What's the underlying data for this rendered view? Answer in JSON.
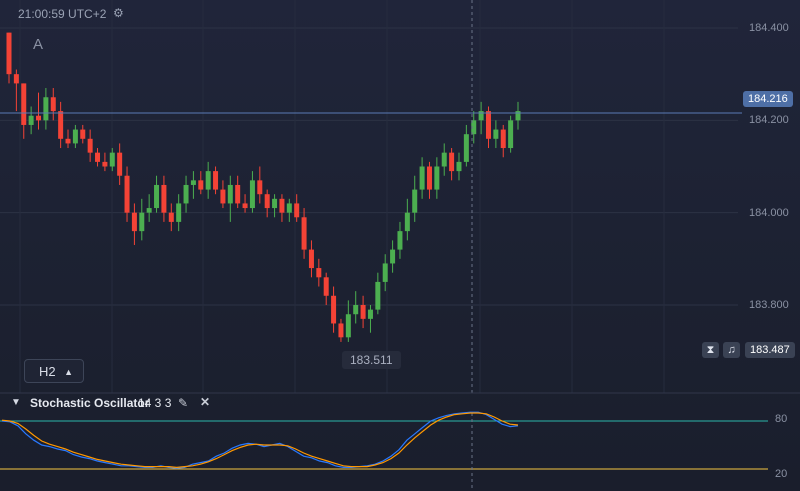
{
  "header": {
    "time": "21:00:59 UTC+2",
    "gear_icon": "gear-icon",
    "series_letter": "A"
  },
  "price_axis": {
    "ticks": [
      "184.400",
      "184.200",
      "184.000",
      "183.800"
    ],
    "current_price": "184.216",
    "ask_price": "183.487",
    "low_marker": "183.511"
  },
  "timeframe_button": {
    "label": "H2",
    "icon": "caret-up-icon"
  },
  "indicator": {
    "name": "Stochastic Oscillator",
    "params": "14 3 3",
    "edit_icon": "pencil-icon",
    "close_icon": "close-icon",
    "levels": [
      "80",
      "20"
    ]
  },
  "colors": {
    "up": "#4caf50",
    "down": "#f44336",
    "k_line": "#2979ff",
    "d_line": "#ff9800",
    "level_80": "#2bb5a9",
    "level_20": "#f5c542",
    "price_tag": "#4e6fa6"
  },
  "chart_data": [
    {
      "type": "candlestick",
      "ylim": [
        183.43,
        184.45
      ],
      "ohlc": [
        [
          184.39,
          184.39,
          184.28,
          184.3
        ],
        [
          184.3,
          184.31,
          184.22,
          184.28
        ],
        [
          184.28,
          184.28,
          184.16,
          184.19
        ],
        [
          184.19,
          184.23,
          184.17,
          184.21
        ],
        [
          184.21,
          184.26,
          184.18,
          184.2
        ],
        [
          184.2,
          184.27,
          184.18,
          184.25
        ],
        [
          184.25,
          184.27,
          184.2,
          184.22
        ],
        [
          184.22,
          184.24,
          184.14,
          184.16
        ],
        [
          184.16,
          184.18,
          184.14,
          184.15
        ],
        [
          184.15,
          184.19,
          184.14,
          184.18
        ],
        [
          184.18,
          184.19,
          184.15,
          184.16
        ],
        [
          184.16,
          184.18,
          184.11,
          184.13
        ],
        [
          184.13,
          184.14,
          184.1,
          184.11
        ],
        [
          184.11,
          184.13,
          184.09,
          184.1
        ],
        [
          184.1,
          184.14,
          184.09,
          184.13
        ],
        [
          184.13,
          184.15,
          184.06,
          184.08
        ],
        [
          184.08,
          184.1,
          183.98,
          184.0
        ],
        [
          184.0,
          184.02,
          183.93,
          183.96
        ],
        [
          183.96,
          184.03,
          183.94,
          184.0
        ],
        [
          184.0,
          184.04,
          183.98,
          184.01
        ],
        [
          184.01,
          184.08,
          184.0,
          184.06
        ],
        [
          184.06,
          184.08,
          183.98,
          184.0
        ],
        [
          184.0,
          184.02,
          183.96,
          183.98
        ],
        [
          183.98,
          184.04,
          183.96,
          184.02
        ],
        [
          184.02,
          184.08,
          184.0,
          184.06
        ],
        [
          184.06,
          184.09,
          184.03,
          184.07
        ],
        [
          184.07,
          184.09,
          184.04,
          184.05
        ],
        [
          184.05,
          184.11,
          184.03,
          184.09
        ],
        [
          184.09,
          184.1,
          184.04,
          184.05
        ],
        [
          184.05,
          184.07,
          184.01,
          184.02
        ],
        [
          184.02,
          184.08,
          183.98,
          184.06
        ],
        [
          184.06,
          184.08,
          184.01,
          184.02
        ],
        [
          184.02,
          184.04,
          184.0,
          184.01
        ],
        [
          184.01,
          184.09,
          184.0,
          184.07
        ],
        [
          184.07,
          184.1,
          184.02,
          184.04
        ],
        [
          184.04,
          184.05,
          183.99,
          184.01
        ],
        [
          184.01,
          184.04,
          183.99,
          184.03
        ],
        [
          184.03,
          184.04,
          183.98,
          184.0
        ],
        [
          184.0,
          184.03,
          183.98,
          184.02
        ],
        [
          184.02,
          184.04,
          183.98,
          183.99
        ],
        [
          183.99,
          184.01,
          183.9,
          183.92
        ],
        [
          183.92,
          183.94,
          183.86,
          183.88
        ],
        [
          183.88,
          183.9,
          183.84,
          183.86
        ],
        [
          183.86,
          183.87,
          183.8,
          183.82
        ],
        [
          183.82,
          183.84,
          183.74,
          183.76
        ],
        [
          183.76,
          183.77,
          183.72,
          183.73
        ],
        [
          183.73,
          183.81,
          183.72,
          183.78
        ],
        [
          183.78,
          183.83,
          183.76,
          183.8
        ],
        [
          183.8,
          183.82,
          183.75,
          183.77
        ],
        [
          183.77,
          183.8,
          183.74,
          183.79
        ],
        [
          183.79,
          183.87,
          183.78,
          183.85
        ],
        [
          183.85,
          183.91,
          183.83,
          183.89
        ],
        [
          183.89,
          183.94,
          183.87,
          183.92
        ],
        [
          183.92,
          183.98,
          183.9,
          183.96
        ],
        [
          183.96,
          184.03,
          183.94,
          184.0
        ],
        [
          184.0,
          184.08,
          183.98,
          184.05
        ],
        [
          184.05,
          184.12,
          184.03,
          184.1
        ],
        [
          184.1,
          184.11,
          184.03,
          184.05
        ],
        [
          184.05,
          184.12,
          184.03,
          184.1
        ],
        [
          184.1,
          184.15,
          184.08,
          184.13
        ],
        [
          184.13,
          184.14,
          184.07,
          184.09
        ],
        [
          184.09,
          184.13,
          184.07,
          184.11
        ],
        [
          184.11,
          184.19,
          184.1,
          184.17
        ],
        [
          184.17,
          184.22,
          184.15,
          184.2
        ],
        [
          184.2,
          184.24,
          184.17,
          184.22
        ],
        [
          184.22,
          184.23,
          184.14,
          184.16
        ],
        [
          184.16,
          184.2,
          184.14,
          184.18
        ],
        [
          184.18,
          184.19,
          184.12,
          184.14
        ],
        [
          184.14,
          184.21,
          184.13,
          184.2
        ],
        [
          184.2,
          184.24,
          184.18,
          184.22
        ]
      ]
    },
    {
      "type": "line",
      "ylim": [
        0,
        100
      ],
      "series": [
        {
          "values": [
            80,
            79,
            74,
            64,
            56,
            50,
            48,
            45,
            43,
            38,
            35,
            33,
            30,
            28,
            26,
            24,
            24,
            23,
            22,
            22,
            24,
            22,
            21,
            22,
            26,
            28,
            30,
            36,
            40,
            46,
            50,
            52,
            51,
            48,
            50,
            52,
            48,
            42,
            36,
            34,
            30,
            28,
            24,
            22,
            22,
            23,
            24,
            26,
            30,
            36,
            44,
            56,
            64,
            72,
            80,
            84,
            87,
            89,
            90,
            91,
            91,
            88,
            82,
            76,
            73,
            74
          ]
        },
        {
          "values": [
            81,
            80,
            77,
            70,
            62,
            55,
            51,
            48,
            45,
            41,
            38,
            35,
            32,
            30,
            28,
            26,
            25,
            24,
            23,
            23,
            23,
            23,
            22,
            23,
            24,
            26,
            29,
            33,
            38,
            43,
            47,
            50,
            51,
            50,
            50,
            50,
            49,
            45,
            40,
            36,
            33,
            30,
            27,
            24,
            23,
            23,
            23,
            25,
            28,
            33,
            40,
            50,
            59,
            67,
            75,
            81,
            85,
            88,
            89,
            90,
            90,
            89,
            85,
            80,
            76,
            75
          ]
        }
      ]
    }
  ]
}
